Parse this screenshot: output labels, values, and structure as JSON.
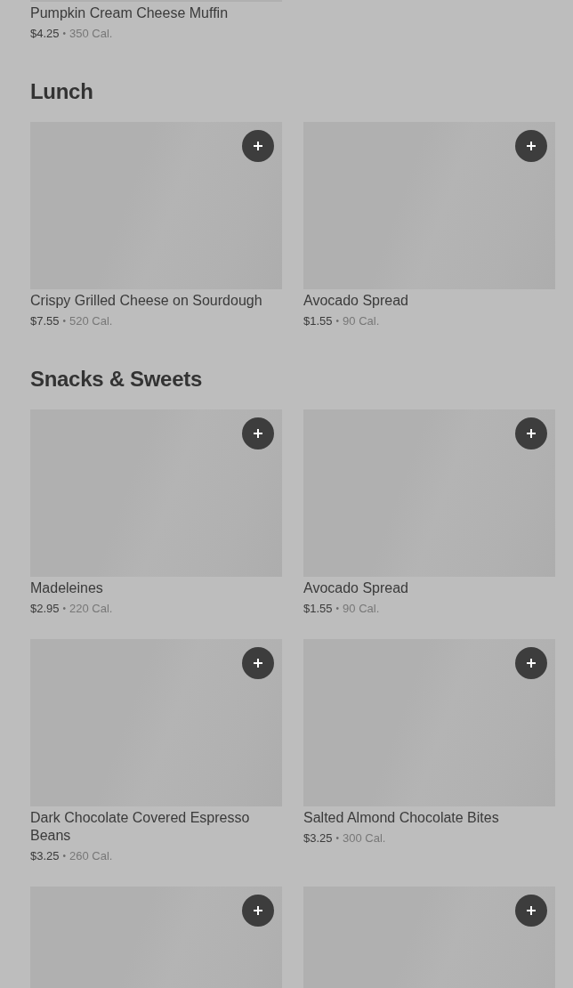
{
  "sections": [
    {
      "items": [
        {
          "kind": "cut",
          "name": "Pumpkin Cream Cheese Muffin",
          "price": "$4.25",
          "separator": "•",
          "calories": "350 Cal."
        }
      ]
    },
    {
      "heading": "Lunch",
      "items": [
        {
          "kind": "card",
          "name": "Crispy Grilled Cheese on Sourdough",
          "price": "$7.55",
          "separator": "•",
          "calories": "520 Cal."
        },
        {
          "kind": "card",
          "name": "Avocado Spread",
          "price": "$1.55",
          "separator": "•",
          "calories": "90 Cal."
        }
      ]
    },
    {
      "heading": "Snacks & Sweets",
      "items": [
        {
          "kind": "card",
          "name": "Madeleines",
          "price": "$2.95",
          "separator": "•",
          "calories": "220 Cal."
        },
        {
          "kind": "card",
          "name": "Avocado Spread",
          "price": "$1.55",
          "separator": "•",
          "calories": "90 Cal."
        },
        {
          "kind": "card",
          "name": "Dark Chocolate Covered Espresso Beans",
          "price": "$3.25",
          "separator": "•",
          "calories": "260 Cal."
        },
        {
          "kind": "card",
          "name": "Salted Almond Chocolate Bites",
          "price": "$3.25",
          "separator": "•",
          "calories": "300 Cal."
        },
        {
          "kind": "card"
        },
        {
          "kind": "card"
        }
      ]
    }
  ]
}
